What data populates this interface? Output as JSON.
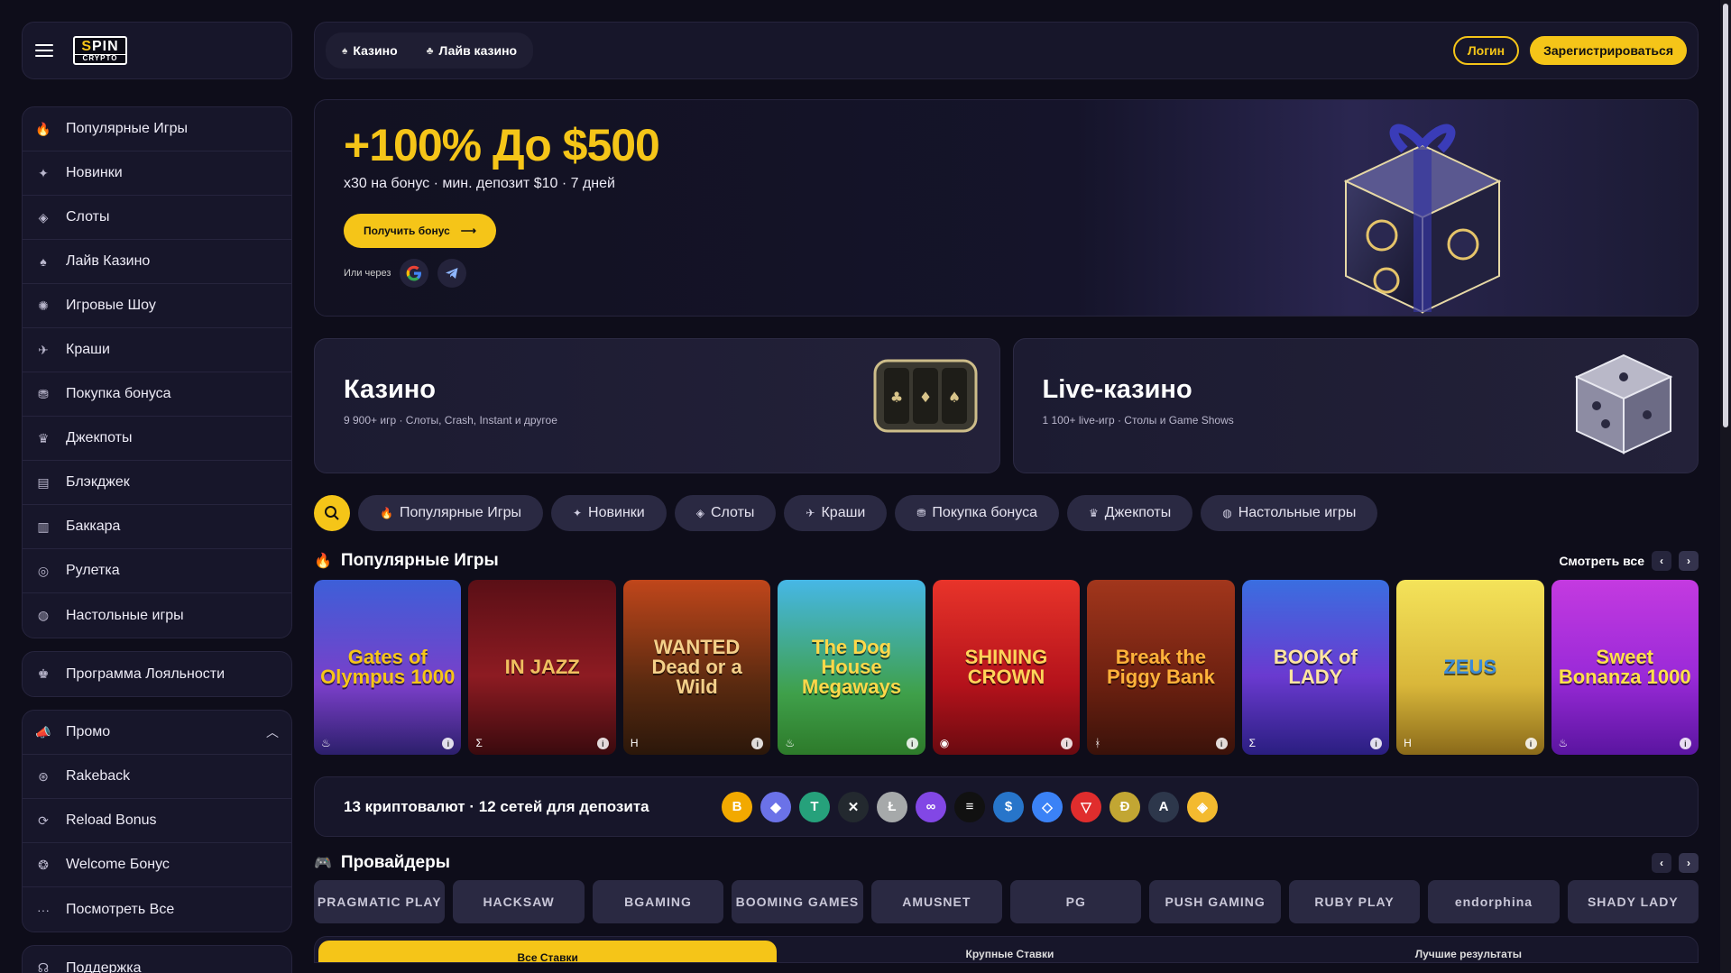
{
  "brand": {
    "logo_line1a": "S",
    "logo_line1b": "PIN",
    "logo_line2": "CRYPTO"
  },
  "sidebar": {
    "categories": [
      {
        "icon": "fire-icon",
        "glyph": "🔥",
        "label": "Популярные Игры"
      },
      {
        "icon": "new-icon",
        "glyph": "✦",
        "label": "Новинки"
      },
      {
        "icon": "slots-icon",
        "glyph": "◈",
        "label": "Слоты"
      },
      {
        "icon": "live-casino-icon",
        "glyph": "♠",
        "label": "Лайв Казино"
      },
      {
        "icon": "game-show-icon",
        "glyph": "✺",
        "label": "Игровые Шоу"
      },
      {
        "icon": "crash-icon",
        "glyph": "✈",
        "label": "Краши"
      },
      {
        "icon": "bonus-buy-icon",
        "glyph": "⛃",
        "label": "Покупка бонуса"
      },
      {
        "icon": "jackpot-icon",
        "glyph": "♛",
        "label": "Джекпоты"
      },
      {
        "icon": "blackjack-icon",
        "glyph": "▤",
        "label": "Блэкджек"
      },
      {
        "icon": "baccarat-icon",
        "glyph": "▥",
        "label": "Баккара"
      },
      {
        "icon": "roulette-icon",
        "glyph": "◎",
        "label": "Рулетка"
      },
      {
        "icon": "table-games-icon",
        "glyph": "◍",
        "label": "Настольные игры"
      }
    ],
    "loyalty": {
      "icon": "crown-icon",
      "glyph": "♚",
      "label": "Программа Лояльности"
    },
    "promo": {
      "header": {
        "icon": "megaphone-icon",
        "glyph": "📣",
        "label": "Промо"
      },
      "items": [
        {
          "icon": "rakeback-icon",
          "glyph": "⊛",
          "label": "Rakeback"
        },
        {
          "icon": "reload-icon",
          "glyph": "⟳",
          "label": "Reload Bonus"
        },
        {
          "icon": "welcome-icon",
          "glyph": "❂",
          "label": "Welcome Бонус"
        },
        {
          "icon": "more-icon",
          "glyph": "···",
          "label": "Посмотреть Все"
        }
      ]
    },
    "support": {
      "icon": "headset-icon",
      "glyph": "☊",
      "label": "Поддержка"
    }
  },
  "topbar": {
    "tabs": [
      {
        "icon": "casino-icon",
        "glyph": "♠",
        "label": "Казино"
      },
      {
        "icon": "live-icon",
        "glyph": "♣",
        "label": "Лайв казино"
      }
    ],
    "login_label": "Логин",
    "register_label": "Зарегистрироваться"
  },
  "hero": {
    "title": "+100% До $500",
    "subtitle": "x30 на бонус · мин. депозит $10 · 7 дней",
    "cta_label": "Получить бонус",
    "alt_label": "Или через"
  },
  "cards": {
    "casino": {
      "title": "Казино",
      "desc": "9 900+ игр · Слоты, Crash, Instant и другое"
    },
    "live": {
      "title": "Live-казино",
      "desc": "1 100+ live-игр · Столы и Game Shows"
    }
  },
  "filters": [
    {
      "icon": "fire-icon",
      "glyph": "🔥",
      "label": "Популярные Игры"
    },
    {
      "icon": "new-icon",
      "glyph": "✦",
      "label": "Новинки"
    },
    {
      "icon": "slots-icon",
      "glyph": "◈",
      "label": "Слоты"
    },
    {
      "icon": "crash-icon",
      "glyph": "✈",
      "label": "Краши"
    },
    {
      "icon": "bonus-buy-icon",
      "glyph": "⛃",
      "label": "Покупка бонуса"
    },
    {
      "icon": "jackpot-icon",
      "glyph": "♛",
      "label": "Джекпоты"
    },
    {
      "icon": "table-games-icon",
      "glyph": "◍",
      "label": "Настольные игры"
    }
  ],
  "popular": {
    "title": "Популярные Игры",
    "view_all": "Смотреть все",
    "games": [
      {
        "name": "Gates of Olympus 1000",
        "bg": "linear-gradient(180deg,#3d5fd8,#7a3fc9 60%,#2c1f6b)",
        "color": "#f5c518",
        "prov": "♨"
      },
      {
        "name": "IN JAZZ",
        "bg": "linear-gradient(180deg,#5a0f16,#8d1b22 55%,#3a0a0e)",
        "color": "#f0c060",
        "prov": "Σ"
      },
      {
        "name": "WANTED Dead or a Wild",
        "bg": "linear-gradient(180deg,#c0461b,#5a2a10 60%,#2b170a)",
        "color": "#f4d08a",
        "prov": "H"
      },
      {
        "name": "The Dog House Megaways",
        "bg": "linear-gradient(180deg,#46b7e6,#3fa04a 65%,#2d7a2a)",
        "color": "#ffd84a",
        "prov": "♨"
      },
      {
        "name": "SHINING CROWN",
        "bg": "linear-gradient(180deg,#e8342a,#b4121b 60%,#6a0a10)",
        "color": "#ffd45a",
        "prov": "◉"
      },
      {
        "name": "Break the Piggy Bank",
        "bg": "linear-gradient(180deg,#a2361c,#6b2010 60%,#3a120a)",
        "color": "#ffb23a",
        "prov": "ᚼ"
      },
      {
        "name": "BOOK of LADY",
        "bg": "linear-gradient(180deg,#3a6ee0,#6a3ad0 55%,#2a1e80)",
        "color": "#ffe5a0",
        "prov": "Σ"
      },
      {
        "name": "ZEUS",
        "bg": "linear-gradient(180deg,#f4e35a,#d9b73a 60%,#8a6a1a)",
        "color": "#3a8ad8",
        "prov": "H"
      },
      {
        "name": "Sweet Bonanza 1000",
        "bg": "linear-gradient(180deg,#c43ae0,#9a2ad8 55%,#5a15a0)",
        "color": "#ffe14a",
        "prov": "♨"
      }
    ]
  },
  "crypto": {
    "text": "13 криптовалют · 12 сетей для депозита",
    "coins": [
      {
        "icon": "bitcoin-icon",
        "glyph": "B",
        "color": "#f2a900"
      },
      {
        "icon": "ethereum-icon",
        "glyph": "◆",
        "color": "#6b72e8"
      },
      {
        "icon": "tether-icon",
        "glyph": "T",
        "color": "#26a17b"
      },
      {
        "icon": "xrp-icon",
        "glyph": "✕",
        "color": "#23292f"
      },
      {
        "icon": "litecoin-icon",
        "glyph": "Ł",
        "color": "#a6a9aa"
      },
      {
        "icon": "polygon-icon",
        "glyph": "∞",
        "color": "#8247e5"
      },
      {
        "icon": "solana-icon",
        "glyph": "≡",
        "color": "#111111"
      },
      {
        "icon": "usdc-icon",
        "glyph": "$",
        "color": "#2775ca"
      },
      {
        "icon": "ton-icon",
        "glyph": "◇",
        "color": "#3b82f6"
      },
      {
        "icon": "tron-icon",
        "glyph": "▽",
        "color": "#e02d2d"
      },
      {
        "icon": "dogecoin-icon",
        "glyph": "Ð",
        "color": "#c2a633"
      },
      {
        "icon": "arbitrum-icon",
        "glyph": "A",
        "color": "#2d374b"
      },
      {
        "icon": "bnb-icon",
        "glyph": "◈",
        "color": "#f3ba2f"
      }
    ]
  },
  "providers": {
    "title": "Провайдеры",
    "items": [
      "PRAGMATIC PLAY",
      "HACKSAW",
      "BGAMING",
      "BOOMING GAMES",
      "AMUSNET",
      "PG",
      "PUSH GAMING",
      "RUBY PLAY",
      "endorphina",
      "SHADY LADY"
    ]
  },
  "bets": {
    "tabs": [
      "Все Ставки",
      "Крупные Ставки",
      "Лучшие результаты"
    ]
  }
}
